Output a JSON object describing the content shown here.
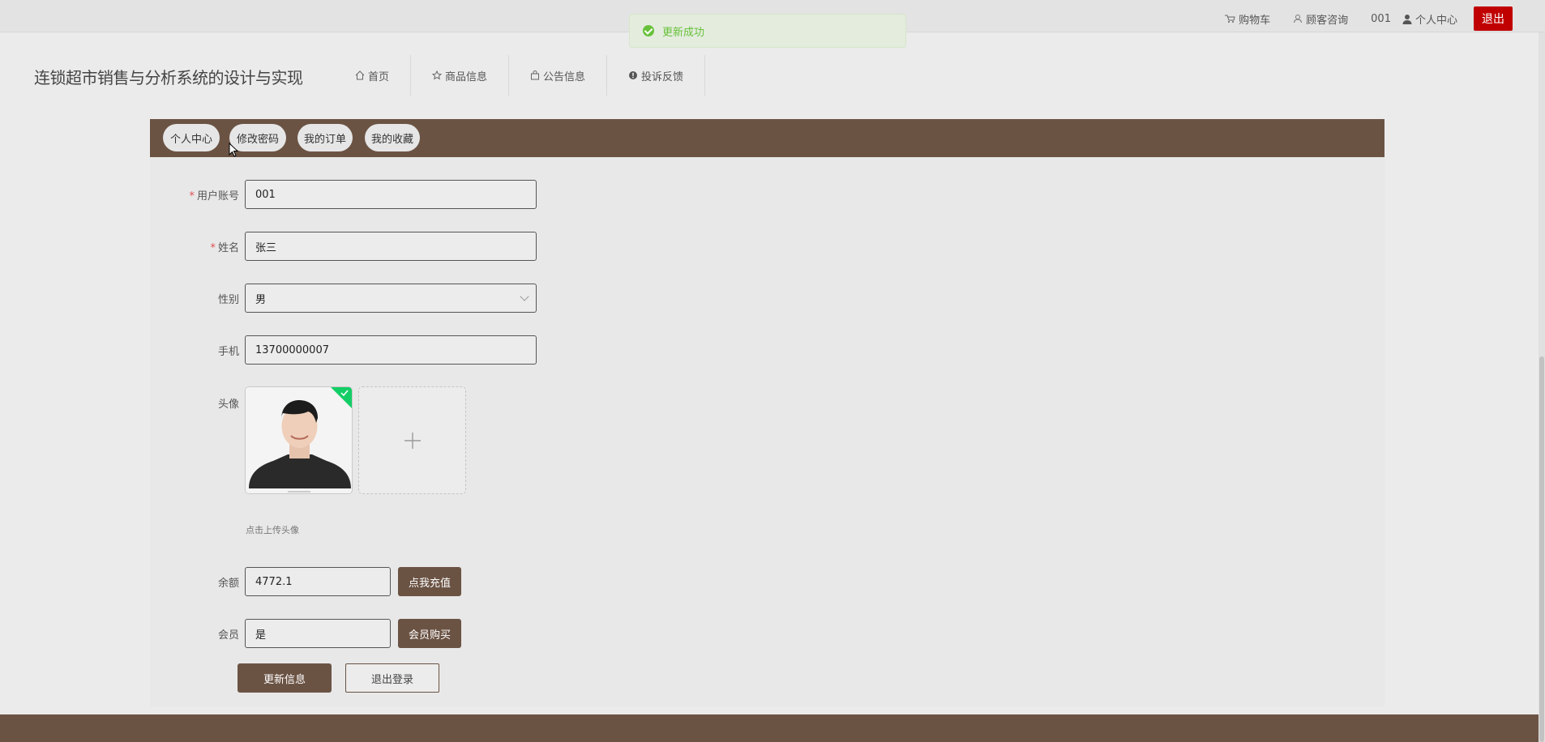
{
  "topbar": {
    "cart": "购物车",
    "service": "顾客咨询",
    "username": "001",
    "center": "个人中心",
    "logout": "退出"
  },
  "toast": {
    "message": "更新成功"
  },
  "brand": {
    "title": "连锁超市销售与分析系统的设计与实现"
  },
  "nav": {
    "items": [
      {
        "label": "首页",
        "icon": "home-icon"
      },
      {
        "label": "商品信息",
        "icon": "star-icon"
      },
      {
        "label": "公告信息",
        "icon": "bag-icon"
      },
      {
        "label": "投诉反馈",
        "icon": "alert-icon"
      }
    ]
  },
  "tabs": [
    "个人中心",
    "修改密码",
    "我的订单",
    "我的收藏"
  ],
  "form": {
    "account_label": "用户账号",
    "account_value": "001",
    "name_label": "姓名",
    "name_value": "张三",
    "gender_label": "性别",
    "gender_value": "男",
    "phone_label": "手机",
    "phone_value": "13700000007",
    "avatar_label": "头像",
    "avatar_hint": "点击上传头像",
    "balance_label": "余额",
    "balance_value": "4772.1",
    "recharge_btn": "点我充值",
    "member_label": "会员",
    "member_value": "是",
    "member_btn": "会员购买",
    "update_btn": "更新信息",
    "logout_btn": "退出登录"
  },
  "colors": {
    "brand_brown": "#6b5344",
    "logout_red": "#c00000",
    "success_green": "#67c23a"
  }
}
